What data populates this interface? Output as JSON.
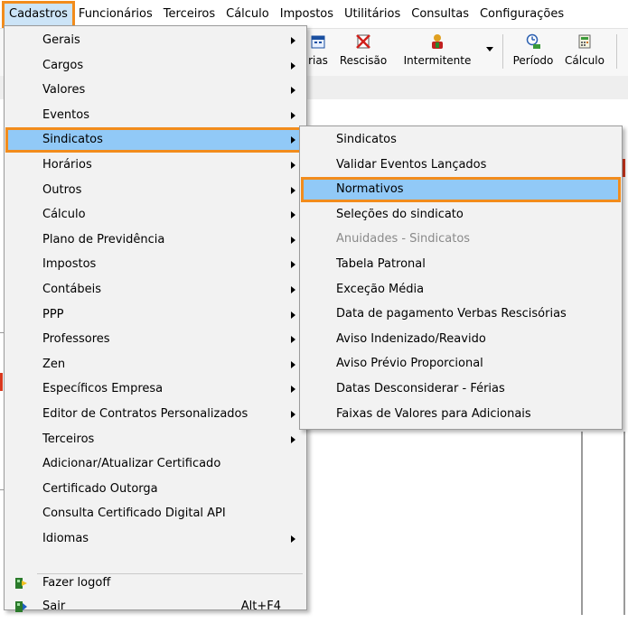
{
  "menubar": {
    "items": [
      "Cadastros",
      "Funcionários",
      "Terceiros",
      "Cálculo",
      "Impostos",
      "Utilitários",
      "Consultas",
      "Configurações"
    ]
  },
  "toolbar": {
    "buttons": [
      {
        "label": "rias",
        "icon": "calendar-icon"
      },
      {
        "label": "Rescisão",
        "icon": "rescission-icon"
      },
      {
        "label": "Intermitente",
        "icon": "intermittent-icon"
      },
      {
        "label": "Período",
        "icon": "period-icon"
      },
      {
        "label": "Cálculo",
        "icon": "calculator-icon"
      }
    ]
  },
  "cadastros_menu": {
    "items": [
      {
        "label": "Gerais",
        "submenu": true
      },
      {
        "label": "Cargos",
        "submenu": true
      },
      {
        "label": "Valores",
        "submenu": true
      },
      {
        "label": "Eventos",
        "submenu": true
      },
      {
        "label": "Sindicatos",
        "submenu": true,
        "highlighted": true
      },
      {
        "label": "Horários",
        "submenu": true
      },
      {
        "label": "Outros",
        "submenu": true
      },
      {
        "label": "Cálculo",
        "submenu": true
      },
      {
        "label": "Plano de Previdência",
        "submenu": true
      },
      {
        "label": "Impostos",
        "submenu": true
      },
      {
        "label": "Contábeis",
        "submenu": true
      },
      {
        "label": "PPP",
        "submenu": true
      },
      {
        "label": "Professores",
        "submenu": true
      },
      {
        "label": "Zen",
        "submenu": true
      },
      {
        "label": "Específicos Empresa",
        "submenu": true
      },
      {
        "label": "Editor de Contratos Personalizados",
        "submenu": true
      },
      {
        "label": "Terceiros",
        "submenu": true
      },
      {
        "label": "Adicionar/Atualizar Certificado"
      },
      {
        "label": "Certificado Outorga"
      },
      {
        "label": "Consulta Certificado Digital API"
      },
      {
        "label": "Idiomas",
        "submenu": true
      }
    ],
    "footer_items": [
      {
        "label": "Fazer logoff",
        "icon": "logoff-icon"
      },
      {
        "label": "Sair",
        "icon": "exit-icon",
        "shortcut": "Alt+F4"
      }
    ]
  },
  "sindicatos_submenu": {
    "items": [
      {
        "label": "Sindicatos"
      },
      {
        "label": "Validar Eventos Lançados"
      },
      {
        "label": "Normativos",
        "highlighted": true
      },
      {
        "label": "Seleções do sindicato"
      },
      {
        "label": "Anuidades - Sindicatos",
        "disabled": true
      },
      {
        "label": "Tabela Patronal"
      },
      {
        "label": "Exceção Média"
      },
      {
        "label": "Data de pagamento Verbas Rescisórias"
      },
      {
        "label": "Aviso Indenizado/Reavido"
      },
      {
        "label": "Aviso Prévio Proporcional"
      },
      {
        "label": "Datas Desconsiderar - Férias"
      },
      {
        "label": "Faixas de Valores para Adicionais"
      }
    ]
  },
  "colors": {
    "accent_outline": "#f28c1c",
    "menu_highlight": "#91c9f7",
    "menu_bg": "#f2f2f2"
  }
}
